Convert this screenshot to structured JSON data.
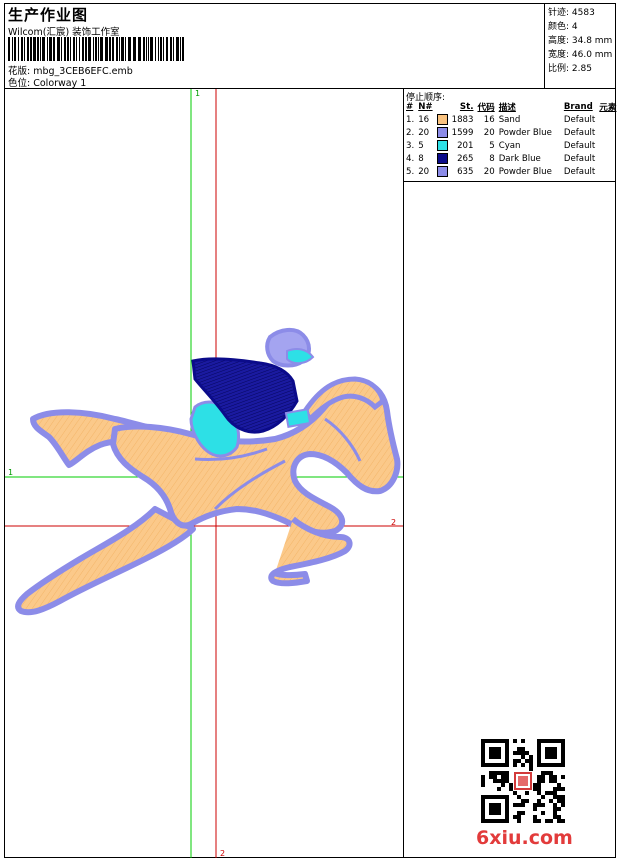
{
  "header": {
    "title": "生产作业图",
    "studio": "Wilcom(汇宸) 装饰工作室",
    "design_label": "花版:",
    "design_value": "mbg_3CEB6EFC.emb",
    "colorway_label": "色位:",
    "colorway_value": "Colorway 1"
  },
  "stats": {
    "stitches": "针迹: 4583",
    "colors": "颜色: 4",
    "height": "高度: 34.8 mm",
    "width": "宽度: 46.0 mm",
    "ratio": "比例: 2.85"
  },
  "stop_sequence": {
    "title": "停止顺序:",
    "headers": [
      "#",
      "N#",
      "St.",
      "代码",
      "描述",
      "Brand",
      "元素"
    ],
    "rows": [
      {
        "idx": "1.",
        "n": "16",
        "color": "#f9c27f",
        "st": "1883",
        "code": "16",
        "desc": "Sand",
        "brand": "Default"
      },
      {
        "idx": "2.",
        "n": "20",
        "color": "#8c8ce8",
        "st": "1599",
        "code": "20",
        "desc": "Powder Blue",
        "brand": "Default"
      },
      {
        "idx": "3.",
        "n": "5",
        "color": "#2de0e6",
        "st": "201",
        "code": "5",
        "desc": "Cyan",
        "brand": "Default"
      },
      {
        "idx": "4.",
        "n": "8",
        "color": "#0b0b8a",
        "st": "265",
        "code": "8",
        "desc": "Dark Blue",
        "brand": "Default"
      },
      {
        "idx": "5.",
        "n": "20",
        "color": "#8c8ce8",
        "st": "635",
        "code": "20",
        "desc": "Powder Blue",
        "brand": "Default"
      }
    ]
  },
  "axes": {
    "label_1": "1",
    "label_2": "2"
  },
  "colors": {
    "sand": "#f9c27f",
    "powder_blue": "#8c8ce8",
    "cyan": "#2de0e6",
    "dark_blue": "#0b0b8a",
    "guide_green": "#00cc00",
    "guide_red": "#cc0000"
  },
  "watermark": "6xiu.com"
}
